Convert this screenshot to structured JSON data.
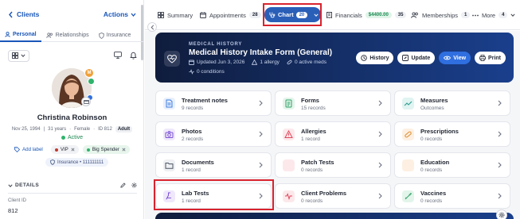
{
  "sidebar": {
    "back_label": "Clients",
    "actions_label": "Actions",
    "tabs": [
      {
        "label": "Personal",
        "active": true
      },
      {
        "label": "Relationships",
        "active": false
      },
      {
        "label": "Insurance",
        "active": false
      }
    ],
    "avatar_badge_letter": "M",
    "client": {
      "name": "Christina Robinson",
      "dob": "Nov 25, 1994",
      "age": "31 years",
      "sex": "Female",
      "id": "ID 812",
      "category": "Adult",
      "status": "Active"
    },
    "tags": {
      "add_label": "Add label",
      "vip": "VIP",
      "big_spender": "Big Spender",
      "insurance": "Insurance • 111111111"
    },
    "details": {
      "heading": "DETAILS",
      "field_label": "Client ID",
      "field_value": "812"
    }
  },
  "top_tabs": {
    "summary": "Summary",
    "appointments": "Appointments",
    "appointments_count": "28",
    "chart": "Chart",
    "chart_count": "20",
    "financials": "Financials",
    "financials_amount": "$4400.00",
    "financials_count": "35",
    "memberships": "Memberships",
    "memberships_count": "1",
    "more": "More",
    "more_count": "4"
  },
  "banner": {
    "eyebrow": "MEDICAL HISTORY",
    "title": "Medical History Intake Form (General)",
    "updated": "Updated Jun 3, 2026",
    "allergy": "1 allergy",
    "meds": "0 active meds",
    "conditions": "0 conditions",
    "buttons": {
      "history": "History",
      "update": "Update",
      "view": "View",
      "print": "Print"
    }
  },
  "cards": [
    {
      "title": "Treatment notes",
      "sub": "9 records",
      "icon": "notes-icon",
      "color": "#3d7be0",
      "bg": "#e8f0fc"
    },
    {
      "title": "Forms",
      "sub": "15 records",
      "icon": "forms-icon",
      "color": "#2fa066",
      "bg": "#e3f5eb"
    },
    {
      "title": "Measures",
      "sub": "Outcomes",
      "icon": "measure-icon",
      "color": "#2a9d8f",
      "bg": "#e0f4f1"
    },
    {
      "title": "Photos",
      "sub": "2 records",
      "icon": "camera-icon",
      "color": "#7a4fd6",
      "bg": "#efe8fb"
    },
    {
      "title": "Allergies",
      "sub": "1 record",
      "icon": "allergy-icon",
      "color": "#e0475c",
      "bg": "#fce8eb"
    },
    {
      "title": "Prescriptions",
      "sub": "0 records",
      "icon": "pill-icon",
      "color": "#e08a2c",
      "bg": "#fdf0e2"
    },
    {
      "title": "Documents",
      "sub": "1 record",
      "icon": "folder-icon",
      "color": "#4b5563",
      "bg": "#eef0f3"
    },
    {
      "title": "Patch Tests",
      "sub": "0 records",
      "icon": "drop-icon",
      "color": "#e0475c",
      "bg": "#fce8eb"
    },
    {
      "title": "Education",
      "sub": "0 records",
      "icon": "book-icon",
      "color": "#e08a2c",
      "bg": "#fdf0e2"
    },
    {
      "title": "Lab Tests",
      "sub": "1 record",
      "icon": "flask-icon",
      "color": "#7a4fd6",
      "bg": "#efe8fb"
    },
    {
      "title": "Client Problems",
      "sub": "0 records",
      "icon": "problem-icon",
      "color": "#e0475c",
      "bg": "#fce8eb"
    },
    {
      "title": "Vaccines",
      "sub": "0 records",
      "icon": "syringe-icon",
      "color": "#2fa066",
      "bg": "#e3f5eb"
    }
  ]
}
